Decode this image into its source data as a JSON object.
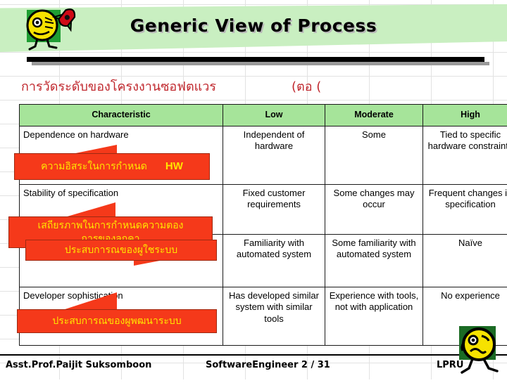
{
  "header": {
    "title": "Generic View of Process",
    "mascot_top_icon": "rocket-mascot-icon"
  },
  "subtitle": {
    "thai_main": "การวัดระดับของโครงงานซอฟตแวร",
    "continued": "(ตอ  ("
  },
  "table": {
    "columns": [
      "Characteristic",
      "Low",
      "Moderate",
      "High"
    ],
    "rows": [
      {
        "characteristic": "Dependence on hardware",
        "low": "Independent of hardware",
        "moderate": "Some",
        "high": "Tied to specific hardware constraints"
      },
      {
        "characteristic": "Stability of specification",
        "low": "Fixed customer requirements",
        "moderate": "Some changes may occur",
        "high": "Frequent changes in specification"
      },
      {
        "characteristic": "",
        "low": "Familiarity with automated system",
        "moderate": "Some familiarity with automated system",
        "high": "Naïve"
      },
      {
        "characteristic": "Developer sophistication",
        "low": "Has developed similar system with similar tools",
        "moderate": "Experience with tools, not with application",
        "high": "No experience"
      }
    ]
  },
  "callouts": [
    {
      "id": "hw",
      "thai": "ความอิสระในการกำหนด",
      "suffix": "HW"
    },
    {
      "id": "stab",
      "thai_line1": "เสถียรภาพในการกำหนดความตอง",
      "thai_line2": "การของลูกคา"
    },
    {
      "id": "user",
      "thai": "ประสบการณของผูใชระบบ"
    },
    {
      "id": "dev",
      "thai": "ประสบการณของผูพฒนาระบบ"
    }
  ],
  "footer": {
    "author": "Asst.Prof.Paijit Suksomboon",
    "course": "SoftwareEngineer 2 / 31",
    "org": "LPRU",
    "mascot_bottom_icon": "worried-face-mascot-icon"
  },
  "colors": {
    "banner_green": "#c9efc1",
    "header_row_green": "#a6e49a",
    "callout_red": "#f5391a",
    "callout_text_yellow": "#ffe400",
    "subtitle_red": "#c0272d"
  }
}
